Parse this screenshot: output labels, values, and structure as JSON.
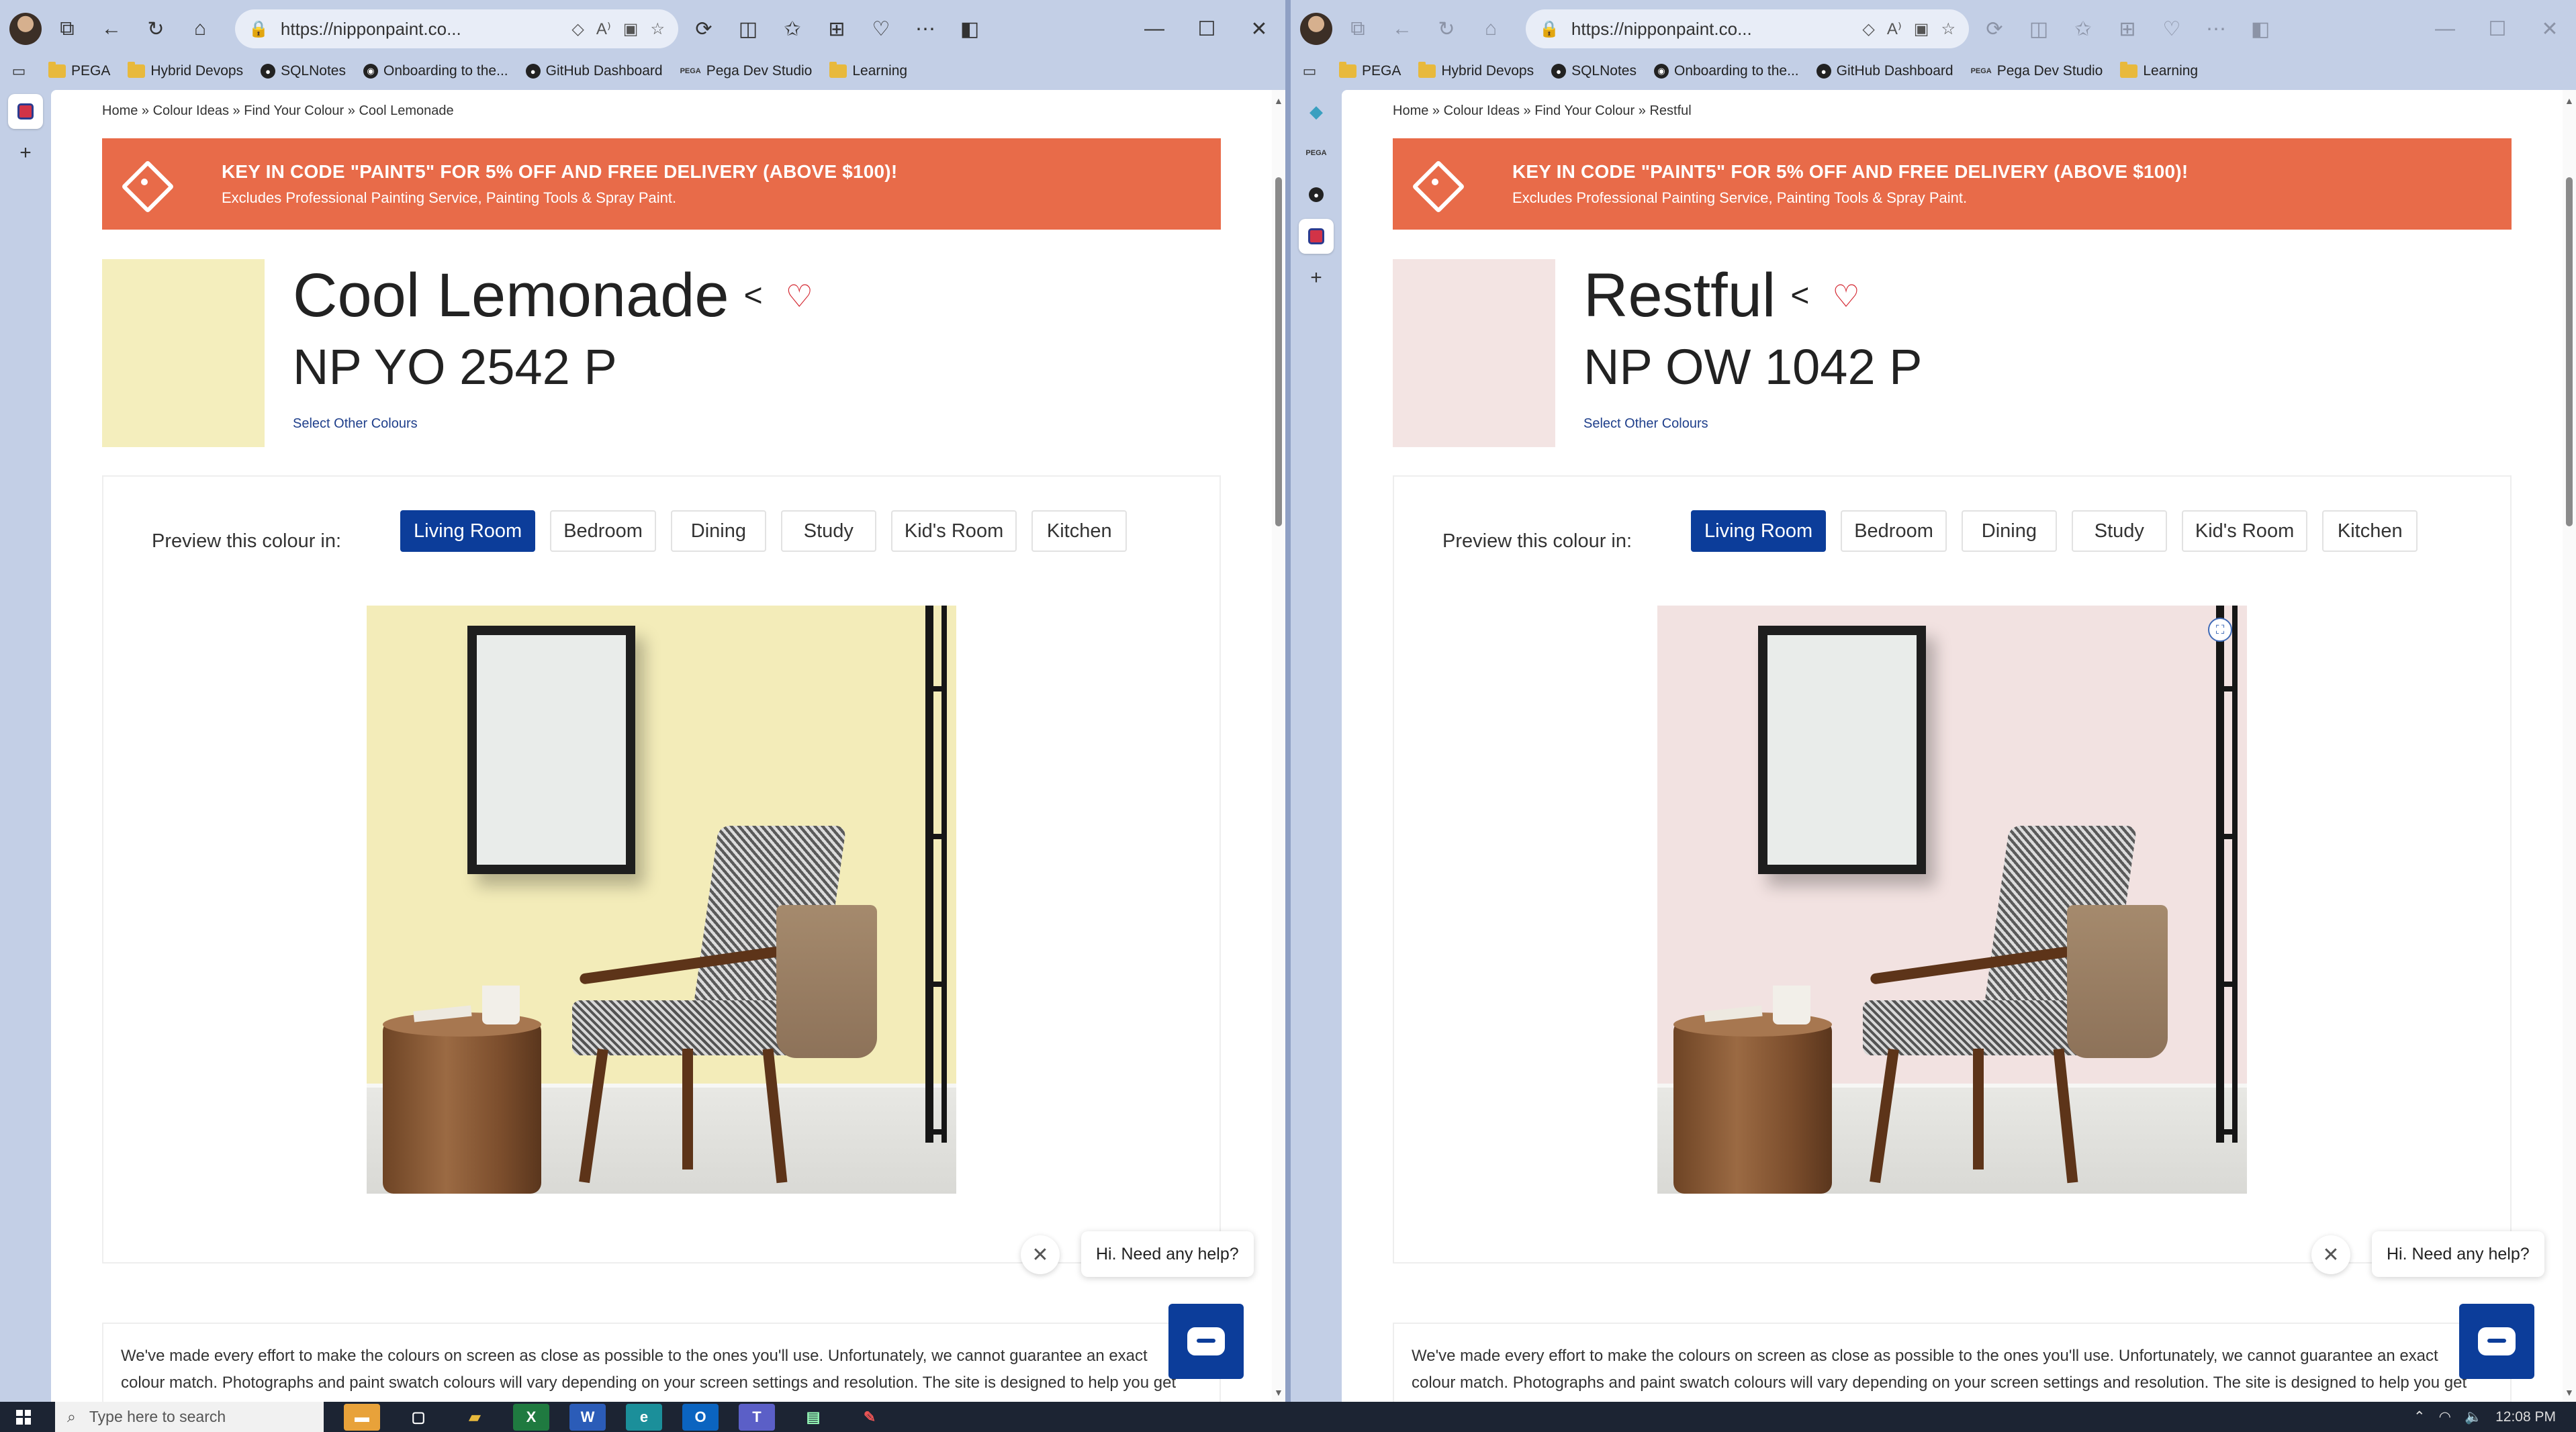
{
  "browser": {
    "address": "https://nipponpaint.co...",
    "favorites": [
      {
        "label": "PEGA",
        "icon": "folder-icon"
      },
      {
        "label": "Hybrid Devops",
        "icon": "folder-icon"
      },
      {
        "label": "SQLNotes",
        "icon": "github-icon"
      },
      {
        "label": "Onboarding to the...",
        "icon": "onboarding-icon"
      },
      {
        "label": "GitHub Dashboard",
        "icon": "github-icon"
      },
      {
        "label": "Pega Dev Studio",
        "icon": "pega-icon"
      },
      {
        "label": "Learning",
        "icon": "folder-icon"
      }
    ],
    "pega_mark": "PEGA"
  },
  "left": {
    "breadcrumb": "Home » Colour Ideas » Find Your Colour » Cool Lemonade",
    "colour_name": "Cool Lemonade",
    "colour_code": "NP YO 2542 P",
    "swatch_color": "#f4eebd",
    "wall_color": "#f3ecb9"
  },
  "right": {
    "breadcrumb": "Home » Colour Ideas » Find Your Colour » Restful",
    "colour_name": "Restful",
    "colour_code": "NP OW 1042 P",
    "swatch_color": "#f3e4e3",
    "wall_color": "#f2e2e1"
  },
  "promo": {
    "headline": "KEY IN CODE \"PAINT5\" FOR 5% OFF AND FREE DELIVERY (ABOVE $100)!",
    "subline": "Excludes Professional Painting Service, Painting Tools & Spray Paint.",
    "color": "#e86b49"
  },
  "select_other": "Select Other Colours",
  "preview_label": "Preview this colour in:",
  "rooms": [
    "Living Room",
    "Bedroom",
    "Dining",
    "Study",
    "Kid's Room",
    "Kitchen"
  ],
  "active_room": "Living Room",
  "chat": {
    "close": "✕",
    "prompt": "Hi. Need any help?"
  },
  "disclaimer": {
    "line1": "We've made every effort to make the colours on screen as close as possible to the ones you'll use. Unfortunately, we cannot guarantee an exact",
    "line2": "colour match. Photographs and paint swatch colours will vary depending on your screen settings and resolution. The site is designed to help you get"
  },
  "taskbar": {
    "search_placeholder": "Type here to search",
    "time": "12:08 PM"
  },
  "accent": "#0c3d9a"
}
